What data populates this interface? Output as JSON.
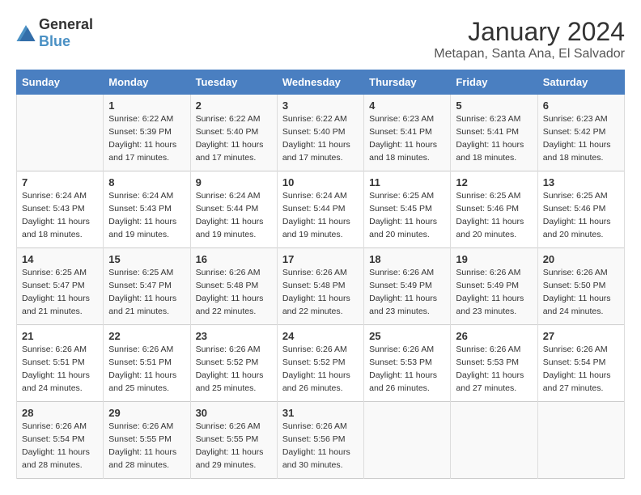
{
  "logo": {
    "general": "General",
    "blue": "Blue"
  },
  "title": "January 2024",
  "subtitle": "Metapan, Santa Ana, El Salvador",
  "days_of_week": [
    "Sunday",
    "Monday",
    "Tuesday",
    "Wednesday",
    "Thursday",
    "Friday",
    "Saturday"
  ],
  "weeks": [
    [
      {
        "day": "",
        "sunrise": "",
        "sunset": "",
        "daylight": ""
      },
      {
        "day": "1",
        "sunrise": "Sunrise: 6:22 AM",
        "sunset": "Sunset: 5:39 PM",
        "daylight": "Daylight: 11 hours and 17 minutes."
      },
      {
        "day": "2",
        "sunrise": "Sunrise: 6:22 AM",
        "sunset": "Sunset: 5:40 PM",
        "daylight": "Daylight: 11 hours and 17 minutes."
      },
      {
        "day": "3",
        "sunrise": "Sunrise: 6:22 AM",
        "sunset": "Sunset: 5:40 PM",
        "daylight": "Daylight: 11 hours and 17 minutes."
      },
      {
        "day": "4",
        "sunrise": "Sunrise: 6:23 AM",
        "sunset": "Sunset: 5:41 PM",
        "daylight": "Daylight: 11 hours and 18 minutes."
      },
      {
        "day": "5",
        "sunrise": "Sunrise: 6:23 AM",
        "sunset": "Sunset: 5:41 PM",
        "daylight": "Daylight: 11 hours and 18 minutes."
      },
      {
        "day": "6",
        "sunrise": "Sunrise: 6:23 AM",
        "sunset": "Sunset: 5:42 PM",
        "daylight": "Daylight: 11 hours and 18 minutes."
      }
    ],
    [
      {
        "day": "7",
        "sunrise": "Sunrise: 6:24 AM",
        "sunset": "Sunset: 5:43 PM",
        "daylight": "Daylight: 11 hours and 18 minutes."
      },
      {
        "day": "8",
        "sunrise": "Sunrise: 6:24 AM",
        "sunset": "Sunset: 5:43 PM",
        "daylight": "Daylight: 11 hours and 19 minutes."
      },
      {
        "day": "9",
        "sunrise": "Sunrise: 6:24 AM",
        "sunset": "Sunset: 5:44 PM",
        "daylight": "Daylight: 11 hours and 19 minutes."
      },
      {
        "day": "10",
        "sunrise": "Sunrise: 6:24 AM",
        "sunset": "Sunset: 5:44 PM",
        "daylight": "Daylight: 11 hours and 19 minutes."
      },
      {
        "day": "11",
        "sunrise": "Sunrise: 6:25 AM",
        "sunset": "Sunset: 5:45 PM",
        "daylight": "Daylight: 11 hours and 20 minutes."
      },
      {
        "day": "12",
        "sunrise": "Sunrise: 6:25 AM",
        "sunset": "Sunset: 5:46 PM",
        "daylight": "Daylight: 11 hours and 20 minutes."
      },
      {
        "day": "13",
        "sunrise": "Sunrise: 6:25 AM",
        "sunset": "Sunset: 5:46 PM",
        "daylight": "Daylight: 11 hours and 20 minutes."
      }
    ],
    [
      {
        "day": "14",
        "sunrise": "Sunrise: 6:25 AM",
        "sunset": "Sunset: 5:47 PM",
        "daylight": "Daylight: 11 hours and 21 minutes."
      },
      {
        "day": "15",
        "sunrise": "Sunrise: 6:25 AM",
        "sunset": "Sunset: 5:47 PM",
        "daylight": "Daylight: 11 hours and 21 minutes."
      },
      {
        "day": "16",
        "sunrise": "Sunrise: 6:26 AM",
        "sunset": "Sunset: 5:48 PM",
        "daylight": "Daylight: 11 hours and 22 minutes."
      },
      {
        "day": "17",
        "sunrise": "Sunrise: 6:26 AM",
        "sunset": "Sunset: 5:48 PM",
        "daylight": "Daylight: 11 hours and 22 minutes."
      },
      {
        "day": "18",
        "sunrise": "Sunrise: 6:26 AM",
        "sunset": "Sunset: 5:49 PM",
        "daylight": "Daylight: 11 hours and 23 minutes."
      },
      {
        "day": "19",
        "sunrise": "Sunrise: 6:26 AM",
        "sunset": "Sunset: 5:49 PM",
        "daylight": "Daylight: 11 hours and 23 minutes."
      },
      {
        "day": "20",
        "sunrise": "Sunrise: 6:26 AM",
        "sunset": "Sunset: 5:50 PM",
        "daylight": "Daylight: 11 hours and 24 minutes."
      }
    ],
    [
      {
        "day": "21",
        "sunrise": "Sunrise: 6:26 AM",
        "sunset": "Sunset: 5:51 PM",
        "daylight": "Daylight: 11 hours and 24 minutes."
      },
      {
        "day": "22",
        "sunrise": "Sunrise: 6:26 AM",
        "sunset": "Sunset: 5:51 PM",
        "daylight": "Daylight: 11 hours and 25 minutes."
      },
      {
        "day": "23",
        "sunrise": "Sunrise: 6:26 AM",
        "sunset": "Sunset: 5:52 PM",
        "daylight": "Daylight: 11 hours and 25 minutes."
      },
      {
        "day": "24",
        "sunrise": "Sunrise: 6:26 AM",
        "sunset": "Sunset: 5:52 PM",
        "daylight": "Daylight: 11 hours and 26 minutes."
      },
      {
        "day": "25",
        "sunrise": "Sunrise: 6:26 AM",
        "sunset": "Sunset: 5:53 PM",
        "daylight": "Daylight: 11 hours and 26 minutes."
      },
      {
        "day": "26",
        "sunrise": "Sunrise: 6:26 AM",
        "sunset": "Sunset: 5:53 PM",
        "daylight": "Daylight: 11 hours and 27 minutes."
      },
      {
        "day": "27",
        "sunrise": "Sunrise: 6:26 AM",
        "sunset": "Sunset: 5:54 PM",
        "daylight": "Daylight: 11 hours and 27 minutes."
      }
    ],
    [
      {
        "day": "28",
        "sunrise": "Sunrise: 6:26 AM",
        "sunset": "Sunset: 5:54 PM",
        "daylight": "Daylight: 11 hours and 28 minutes."
      },
      {
        "day": "29",
        "sunrise": "Sunrise: 6:26 AM",
        "sunset": "Sunset: 5:55 PM",
        "daylight": "Daylight: 11 hours and 28 minutes."
      },
      {
        "day": "30",
        "sunrise": "Sunrise: 6:26 AM",
        "sunset": "Sunset: 5:55 PM",
        "daylight": "Daylight: 11 hours and 29 minutes."
      },
      {
        "day": "31",
        "sunrise": "Sunrise: 6:26 AM",
        "sunset": "Sunset: 5:56 PM",
        "daylight": "Daylight: 11 hours and 30 minutes."
      },
      {
        "day": "",
        "sunrise": "",
        "sunset": "",
        "daylight": ""
      },
      {
        "day": "",
        "sunrise": "",
        "sunset": "",
        "daylight": ""
      },
      {
        "day": "",
        "sunrise": "",
        "sunset": "",
        "daylight": ""
      }
    ]
  ]
}
